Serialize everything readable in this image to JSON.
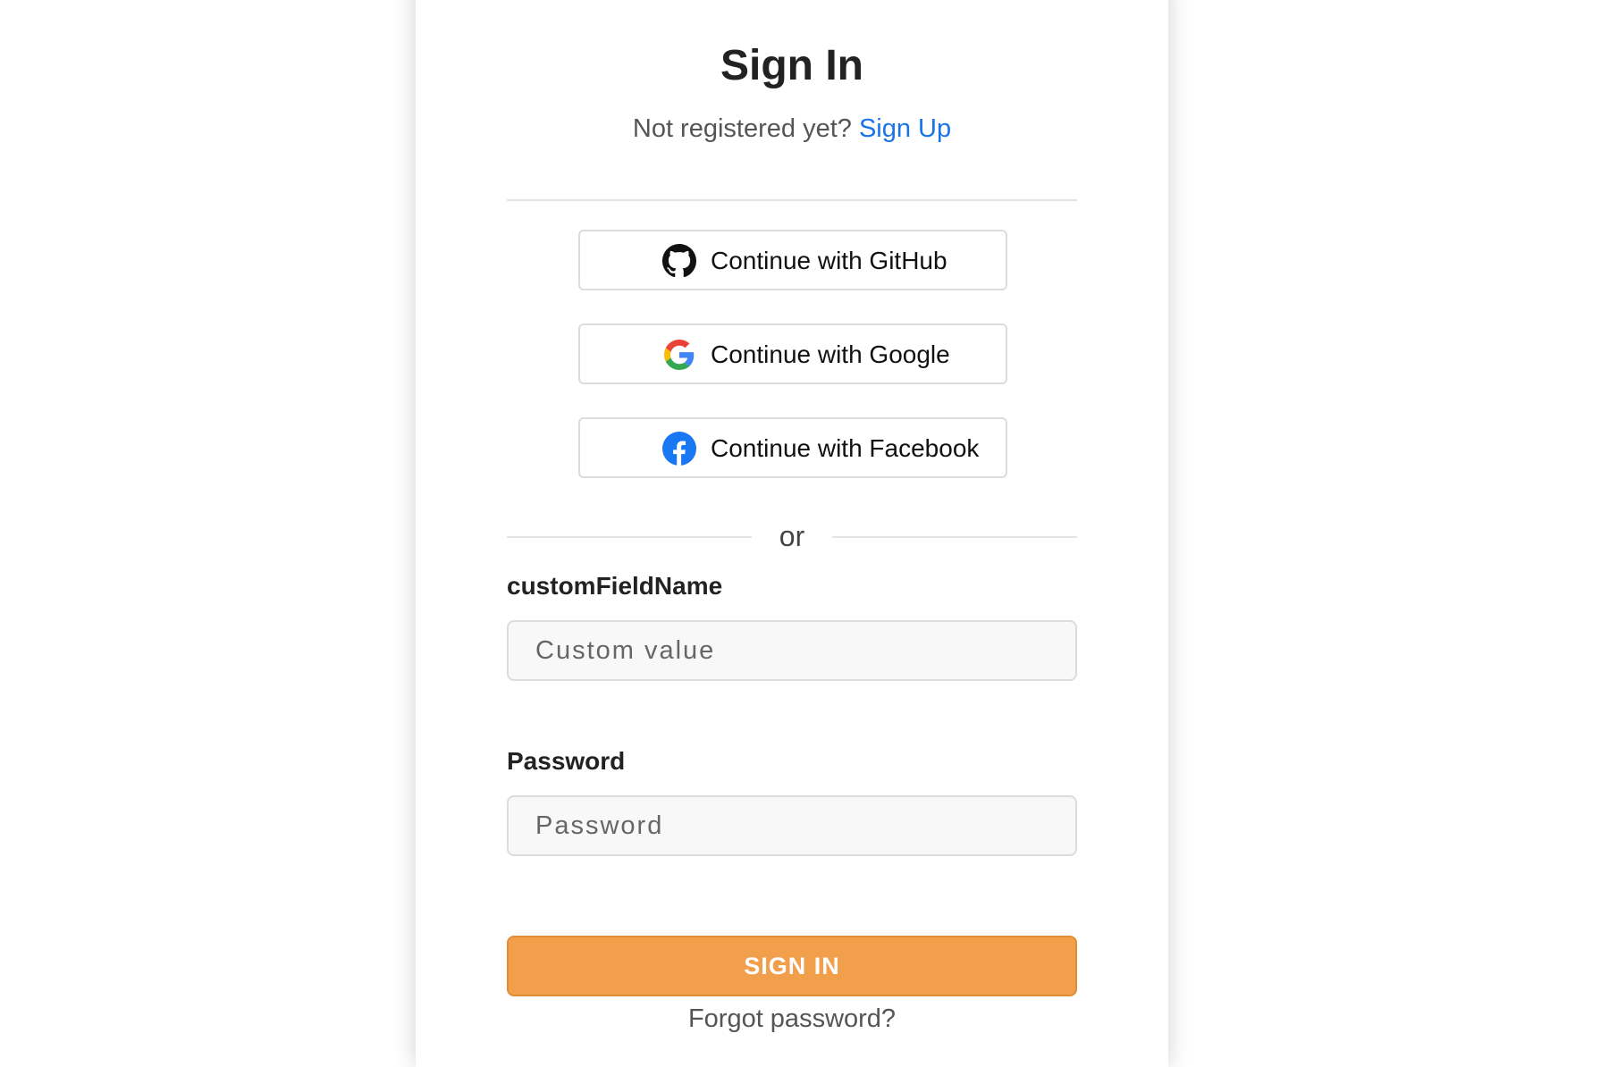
{
  "header": {
    "title": "Sign In",
    "prompt": "Not registered yet?",
    "signup_link": "Sign Up"
  },
  "social": [
    {
      "label": "Continue with GitHub",
      "icon": "github-icon"
    },
    {
      "label": "Continue with Google",
      "icon": "google-icon"
    },
    {
      "label": "Continue with Facebook",
      "icon": "facebook-icon"
    }
  ],
  "separator": "or",
  "form": {
    "custom_label": "customFieldName",
    "custom_placeholder": "Custom value",
    "custom_value": "",
    "password_label": "Password",
    "password_placeholder": "Password",
    "password_value": "",
    "submit_label": "SIGN IN",
    "forgot_label": "Forgot password?"
  },
  "colors": {
    "accent": "#f29f4b",
    "link": "#1a73e8",
    "facebook": "#1877f2"
  }
}
